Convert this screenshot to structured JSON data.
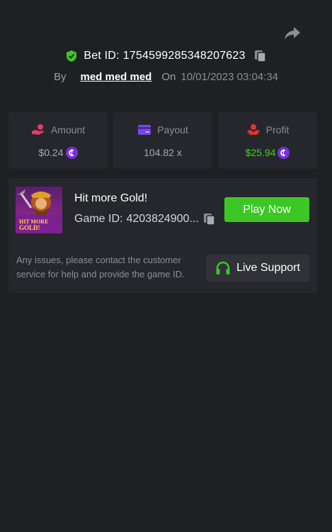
{
  "header": {
    "bet_id_label": "Bet ID:",
    "bet_id": "1754599285348207623",
    "by_label": "By",
    "username": "med med med",
    "on_label": "On",
    "datetime": "10/01/2023 03:04:34"
  },
  "stats": {
    "amount": {
      "label": "Amount",
      "value": "$0.24"
    },
    "payout": {
      "label": "Payout",
      "value": "104.82 x"
    },
    "profit": {
      "label": "Profit",
      "value": "$25.94"
    }
  },
  "game": {
    "title": "Hit more Gold!",
    "id_label": "Game ID:",
    "id_value": "4203824900...",
    "thumb_text_line1": "HIT MORE",
    "thumb_text_line2": "GOLD!",
    "play_label": "Play Now"
  },
  "support": {
    "note": "Any issues, please contact the customer service for help and provide the game ID.",
    "button_label": "Live Support"
  },
  "colors": {
    "background": "#1f2024",
    "card": "#26272c",
    "accent_green": "#3dc726",
    "profit_green": "#3fd11f",
    "coin_purple": "#7a2fe0"
  },
  "icons": [
    "share-icon",
    "shield-check-icon",
    "copy-icon",
    "amount-hand-icon",
    "payout-card-icon",
    "profit-hand-icon",
    "coin-icon",
    "headset-icon"
  ]
}
